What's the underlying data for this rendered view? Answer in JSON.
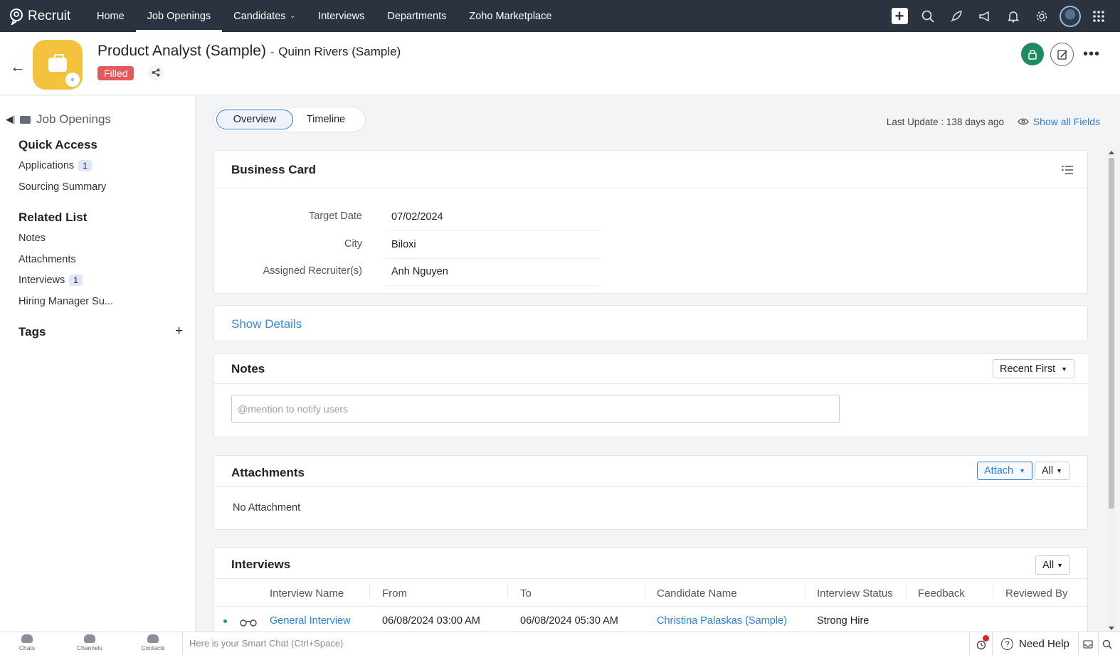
{
  "nav": {
    "brand": "Recruit",
    "links": [
      "Home",
      "Job Openings",
      "Candidates",
      "Interviews",
      "Departments",
      "Zoho Marketplace"
    ],
    "icons": [
      "plus-icon",
      "search-icon",
      "rocket-icon",
      "megaphone-icon",
      "bell-icon",
      "gear-icon",
      "avatar",
      "apps-grid-icon"
    ]
  },
  "record": {
    "title": "Product Analyst (Sample)",
    "separator": "-",
    "subtitle": "Quinn Rivers (Sample)",
    "status": "Filled",
    "status_color": "#e25a5a",
    "icon_color": "#f3c340"
  },
  "sidebar": {
    "module": "Job Openings",
    "quick_access": {
      "heading": "Quick Access",
      "items": [
        {
          "label": "Applications",
          "count": "1"
        },
        {
          "label": "Sourcing Summary",
          "count": ""
        }
      ]
    },
    "related_list": {
      "heading": "Related List",
      "items": [
        {
          "label": "Notes",
          "count": ""
        },
        {
          "label": "Attachments",
          "count": ""
        },
        {
          "label": "Interviews",
          "count": "1"
        },
        {
          "label": "Hiring Manager Su...",
          "count": ""
        }
      ]
    },
    "tags_heading": "Tags",
    "add_symbol": "+"
  },
  "main": {
    "tabs": [
      "Overview",
      "Timeline"
    ],
    "last_update": "Last Update : 138 days ago",
    "show_all_fields": "Show all Fields"
  },
  "business_card": {
    "title": "Business Card",
    "fields": [
      {
        "label": "Target Date",
        "value": "07/02/2024"
      },
      {
        "label": "City",
        "value": "Biloxi"
      },
      {
        "label": "Assigned Recruiter(s)",
        "value": "Anh Nguyen"
      }
    ]
  },
  "show_details": "Show Details",
  "notes": {
    "title": "Notes",
    "sort": "Recent First",
    "placeholder": "@mention to notify users"
  },
  "attachments": {
    "title": "Attachments",
    "attach_label": "Attach",
    "filter": "All",
    "empty": "No Attachment"
  },
  "interviews": {
    "title": "Interviews",
    "filter": "All",
    "columns": [
      "Interview Name",
      "From",
      "To",
      "Candidate Name",
      "Interview Status",
      "Feedback",
      "Reviewed By"
    ],
    "rows": [
      {
        "name": "General Interview",
        "from": "06/08/2024 03:00 AM",
        "to": "06/08/2024 05:30 AM",
        "candidate": "Christina Palaskas (Sample)",
        "status": "Strong Hire",
        "feedback": "",
        "reviewed_by": ""
      }
    ]
  },
  "bottombar": {
    "items": [
      "Chats",
      "Channels",
      "Contacts"
    ],
    "smart_chat": "Here is your Smart Chat (Ctrl+Space)",
    "need_help": "Need Help"
  },
  "colors": {
    "nav_bg": "#2b3340",
    "link": "#2f7fd3",
    "lock_green": "#1f8a5e"
  }
}
